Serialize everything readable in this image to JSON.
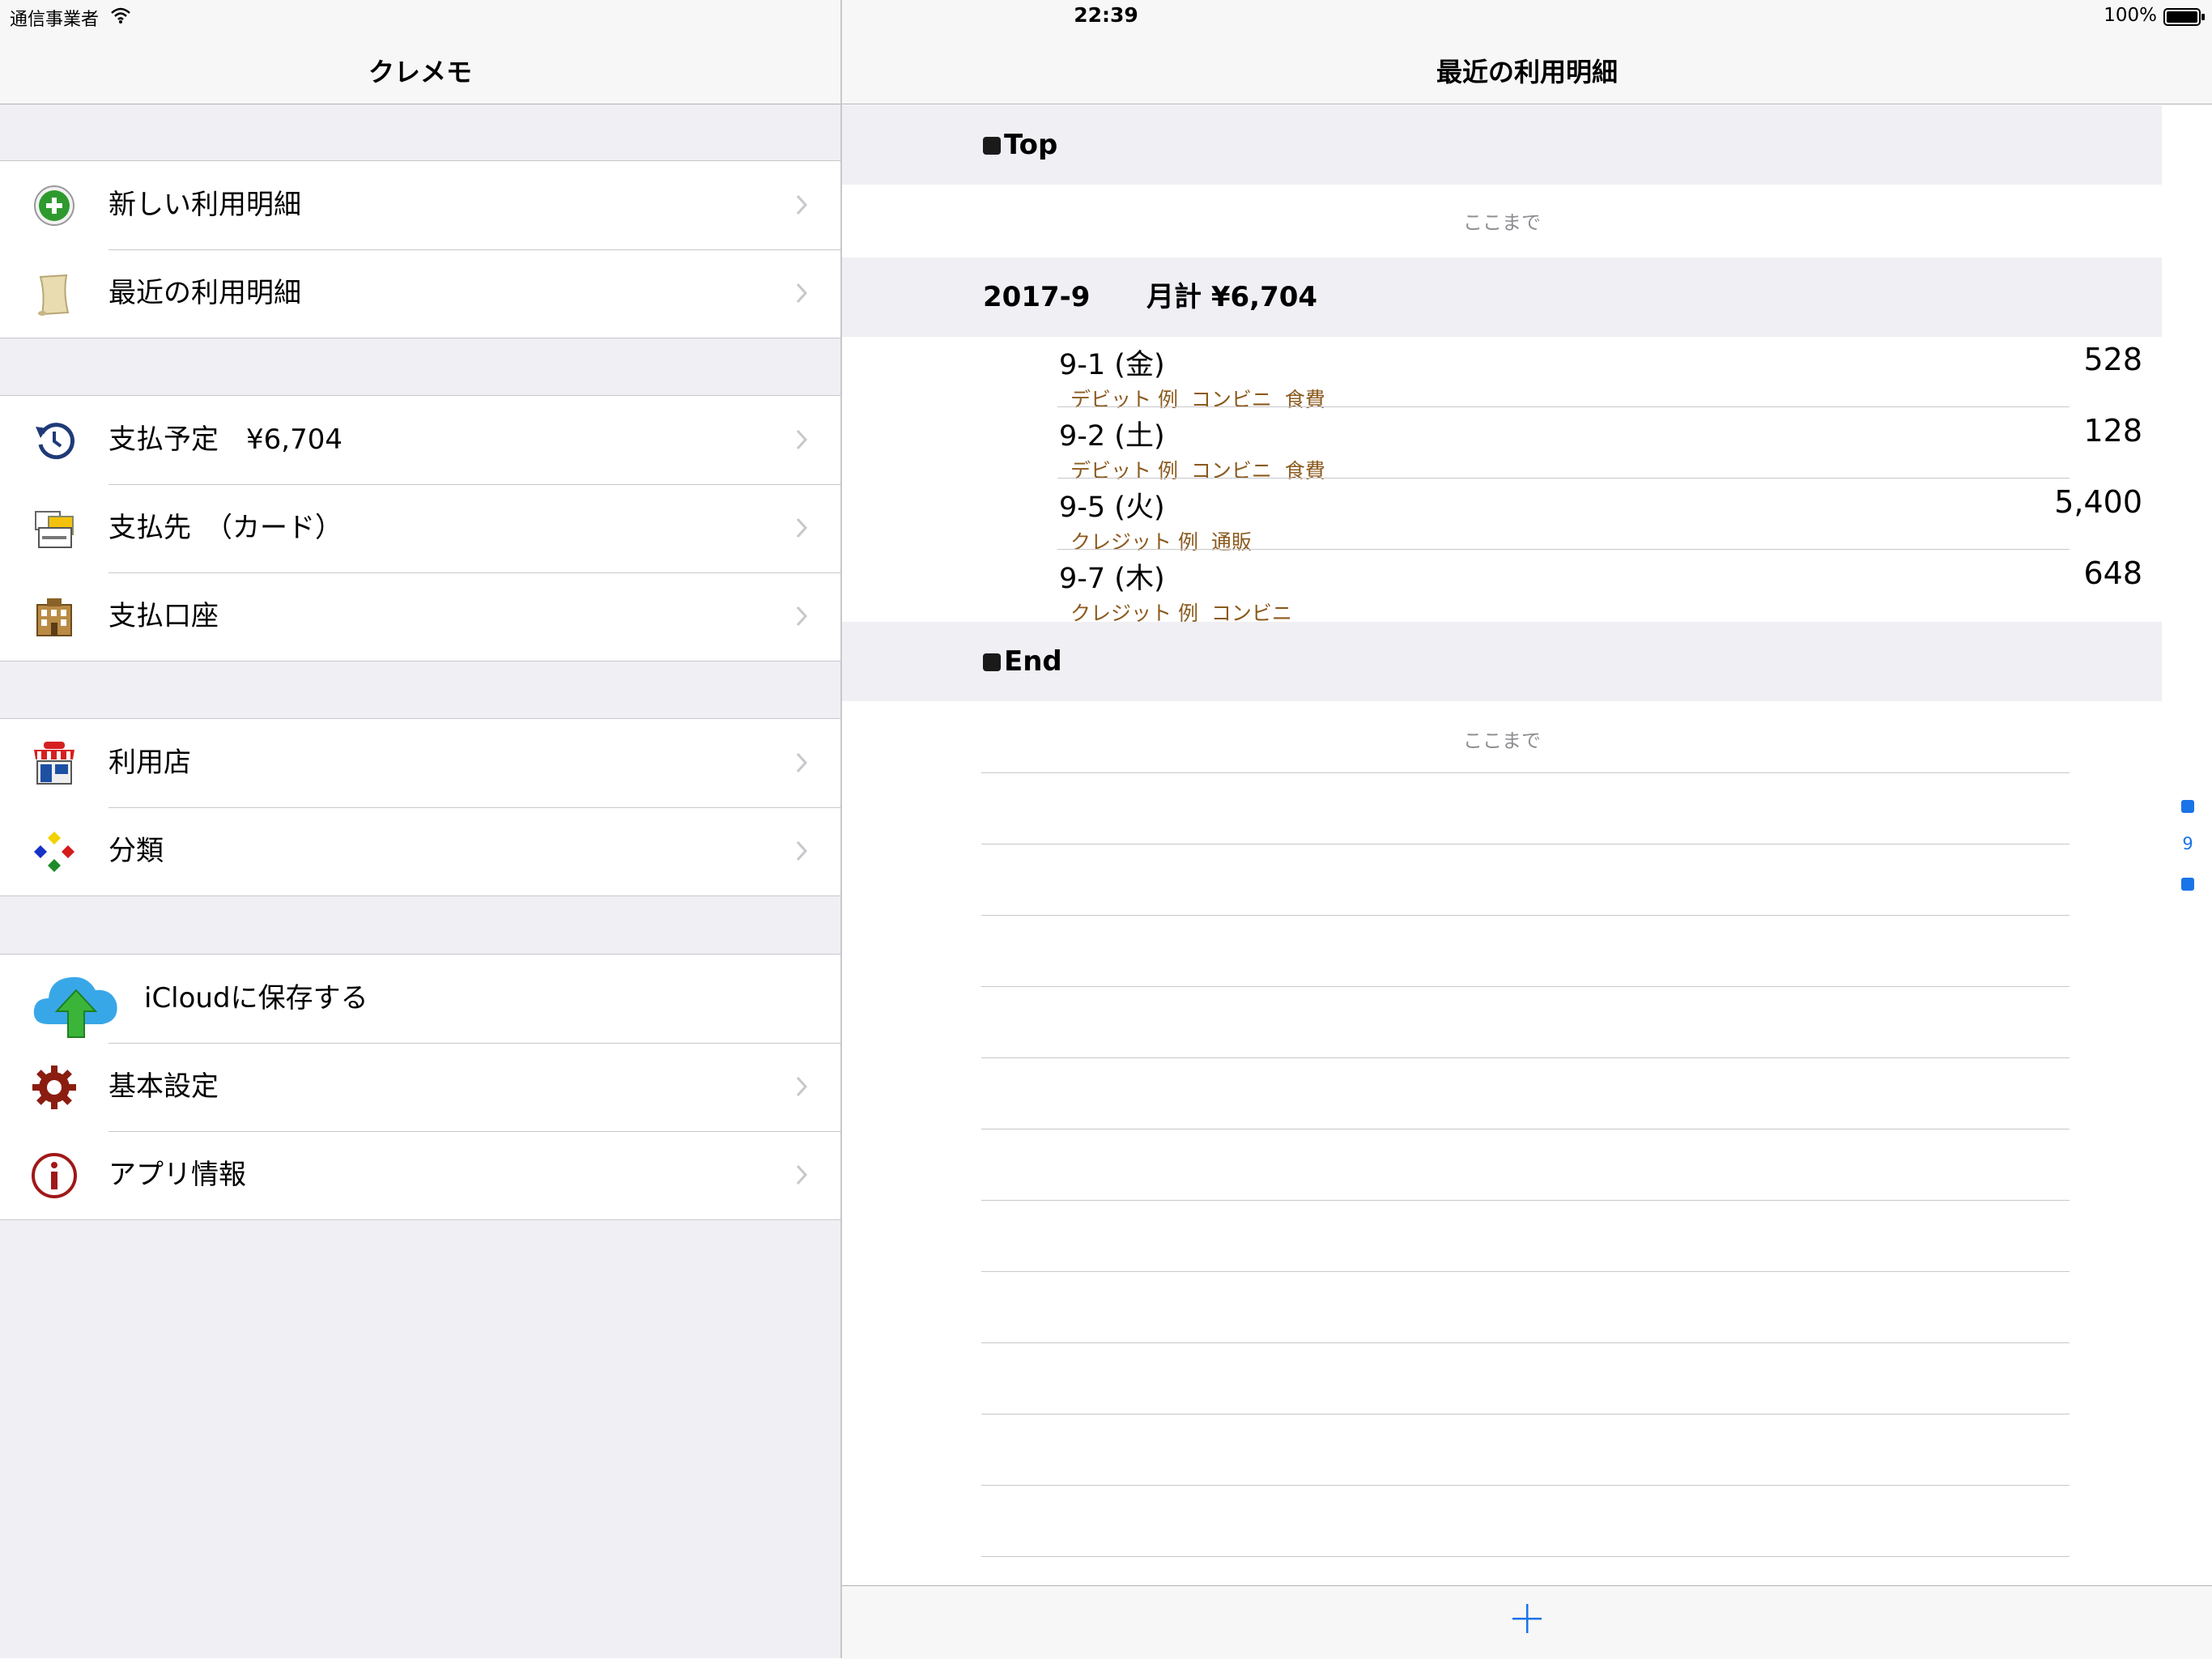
{
  "status_bar": {
    "carrier": "通信事業者",
    "time": "22:39",
    "battery": "100%"
  },
  "master": {
    "title": "クレメモ",
    "groups": [
      {
        "items": [
          {
            "label": "新しい利用明細",
            "icon": "add-circle-icon"
          },
          {
            "label": "最近の利用明細",
            "icon": "scroll-icon"
          }
        ]
      },
      {
        "items": [
          {
            "label": "支払予定　¥6,704",
            "icon": "history-icon"
          },
          {
            "label": "支払先　（カード）",
            "icon": "payment-card-icon"
          },
          {
            "label": "支払口座",
            "icon": "bank-icon"
          }
        ]
      },
      {
        "items": [
          {
            "label": "利用店",
            "icon": "shop-icon"
          },
          {
            "label": "分類",
            "icon": "category-diamonds-icon"
          }
        ]
      },
      {
        "items": [
          {
            "label": "iCloudに保存する",
            "icon": "icloud-upload-icon"
          },
          {
            "label": "基本設定",
            "icon": "gear-icon"
          },
          {
            "label": "アプリ情報",
            "icon": "info-icon"
          }
        ]
      }
    ]
  },
  "detail": {
    "title": "最近の利用明細",
    "top_header": "Top",
    "top_footer": "ここまで",
    "month_section": {
      "month": "2017-9",
      "total": "月計 ¥6,704"
    },
    "transactions": [
      {
        "date": "9-1 (金)",
        "detail": "デビット 例  コンビニ  食費",
        "amount": "528"
      },
      {
        "date": "9-2 (土)",
        "detail": "デビット 例  コンビニ  食費",
        "amount": "128"
      },
      {
        "date": "9-5 (火)",
        "detail": "クレジット 例  通販",
        "amount": "5,400"
      },
      {
        "date": "9-7 (木)",
        "detail": "クレジット 例  コンビニ",
        "amount": "648"
      }
    ],
    "end_header": "End",
    "end_footer": "ここまで",
    "section_index": "9"
  },
  "colors": {
    "accent": "#1a73e8",
    "subtext": "#8b5a1e",
    "group_bg": "#efeff4",
    "separator": "#c8c7cc"
  }
}
